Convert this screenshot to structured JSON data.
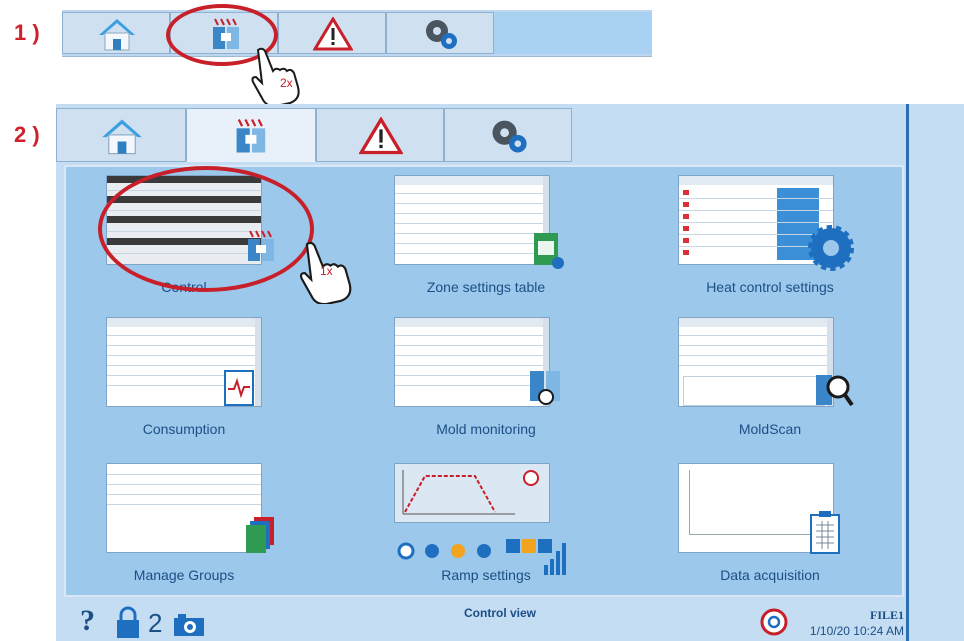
{
  "steps": {
    "one": "1 )",
    "two": "2 )"
  },
  "tabs": [
    {
      "name": "home",
      "icon": "home-icon"
    },
    {
      "name": "control",
      "icon": "mold-heating-icon"
    },
    {
      "name": "alarms",
      "icon": "warning-icon"
    },
    {
      "name": "settings",
      "icon": "gears-icon"
    }
  ],
  "annotations": {
    "double_click": "2x",
    "single_click": "1x"
  },
  "menu": [
    {
      "label": "Control"
    },
    {
      "label": "Zone settings table"
    },
    {
      "label": "Heat control settings"
    },
    {
      "label": "Consumption"
    },
    {
      "label": "Mold monitoring"
    },
    {
      "label": "MoldScan"
    },
    {
      "label": "Manage Groups"
    },
    {
      "label": "Ramp settings"
    },
    {
      "label": "Data acquisition"
    }
  ],
  "status": {
    "help": "?",
    "access_level": "2",
    "view_title": "Control view",
    "file": "FILE1",
    "datetime": "1/10/20 10:24 AM"
  },
  "colors": {
    "accent": "#1c4f86",
    "highlight": "#c8202a",
    "panel": "#9cc8eb"
  }
}
